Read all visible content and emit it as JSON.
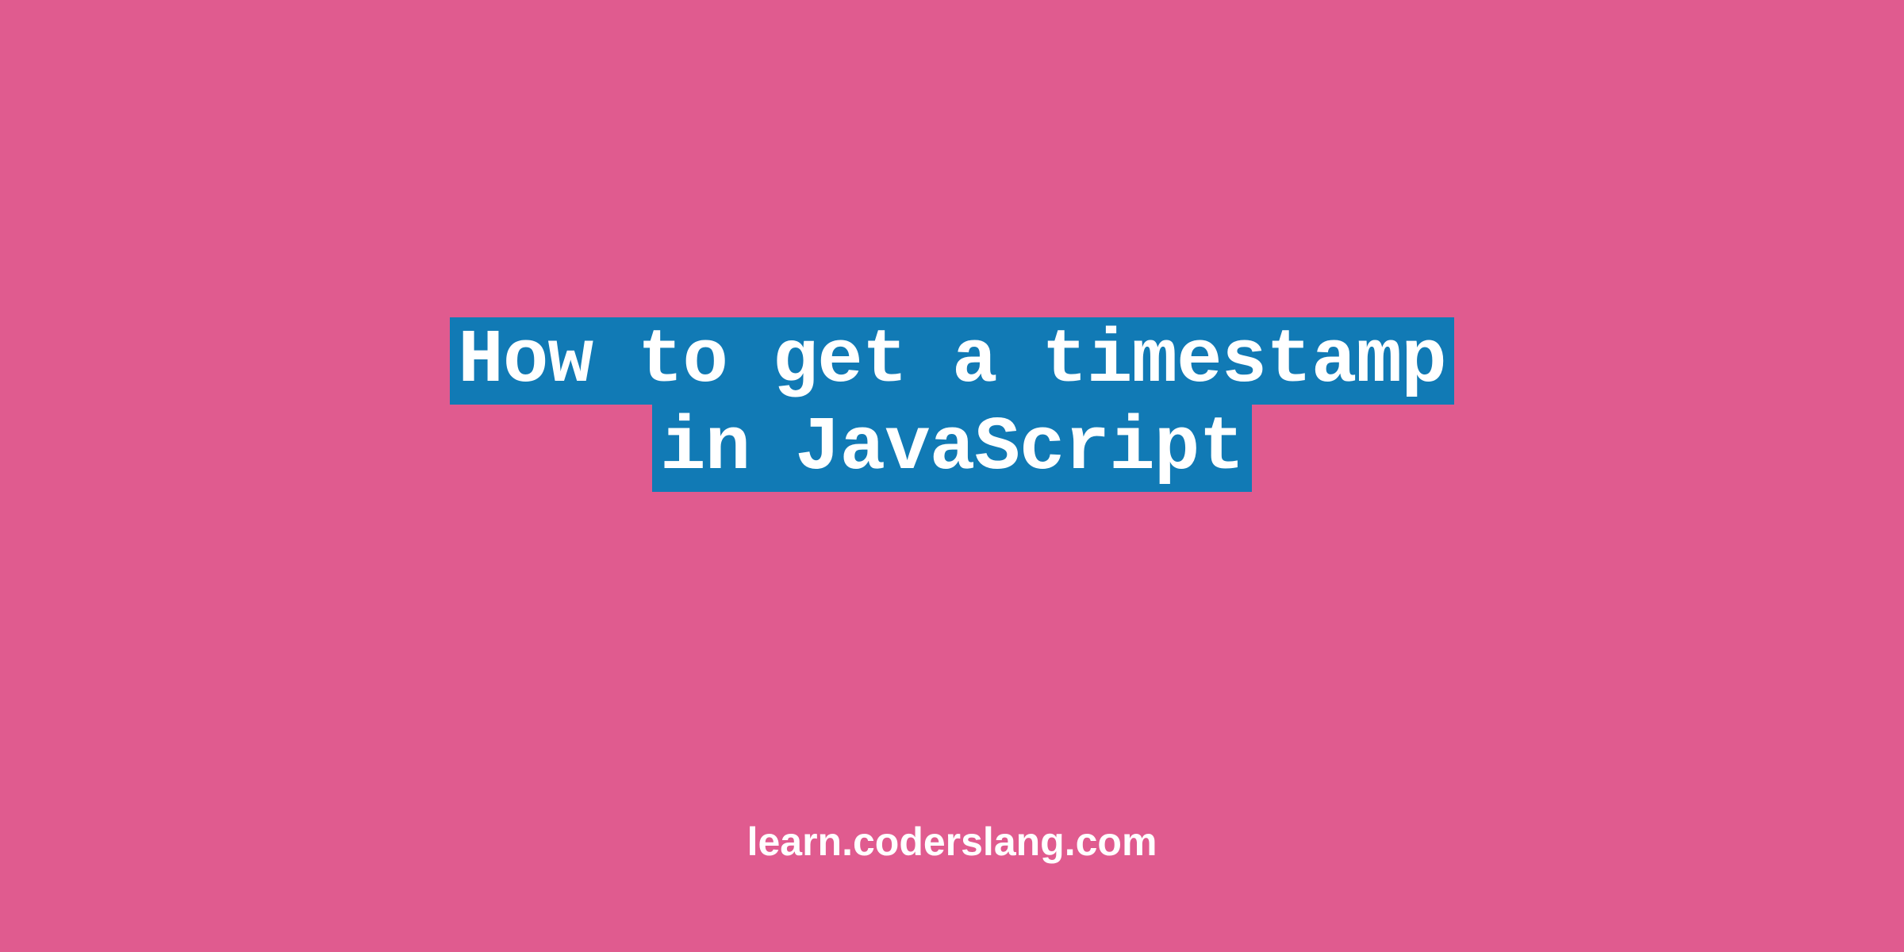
{
  "title": {
    "line1": "How to get a timestamp",
    "line2": " in JavaScript "
  },
  "footer": {
    "site": "learn.coderslang.com"
  },
  "colors": {
    "background": "#e05b8f",
    "highlight": "#117ab5",
    "text": "#ffffff"
  }
}
